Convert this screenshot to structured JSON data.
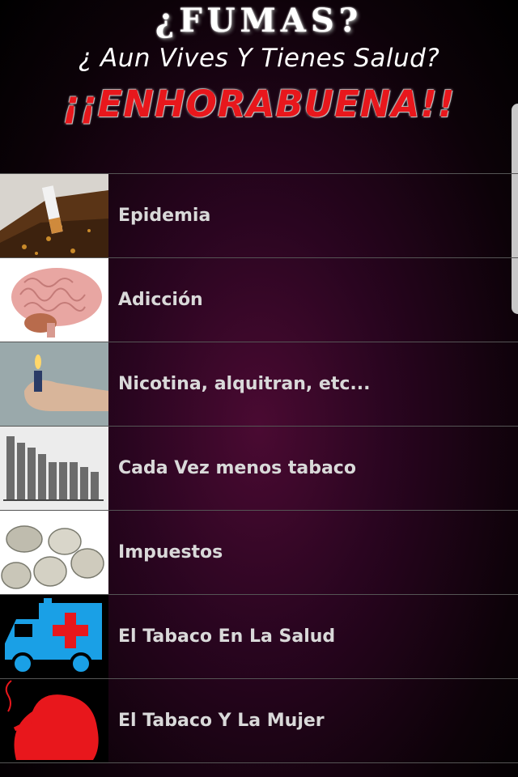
{
  "header": {
    "title": "¿FUMAS?",
    "subtitle": "¿ Aun Vives Y Tienes Salud?",
    "congrats": "¡¡ENHORABUENA!!"
  },
  "menu": [
    {
      "label": "Epidemia",
      "icon": "cigarette-image"
    },
    {
      "label": "Adicción",
      "icon": "brain-image"
    },
    {
      "label": "Nicotina, alquitran, etc...",
      "icon": "lighter-hand-image"
    },
    {
      "label": "Cada Vez menos tabaco",
      "icon": "bar-chart-image"
    },
    {
      "label": "Impuestos",
      "icon": "coins-image"
    },
    {
      "label": "El Tabaco En La Salud",
      "icon": "ambulance-icon"
    },
    {
      "label": "El Tabaco Y La Mujer",
      "icon": "woman-smoking-icon"
    }
  ],
  "colors": {
    "accent_red": "#e8171c",
    "ambulance_blue": "#1aa0e6"
  }
}
